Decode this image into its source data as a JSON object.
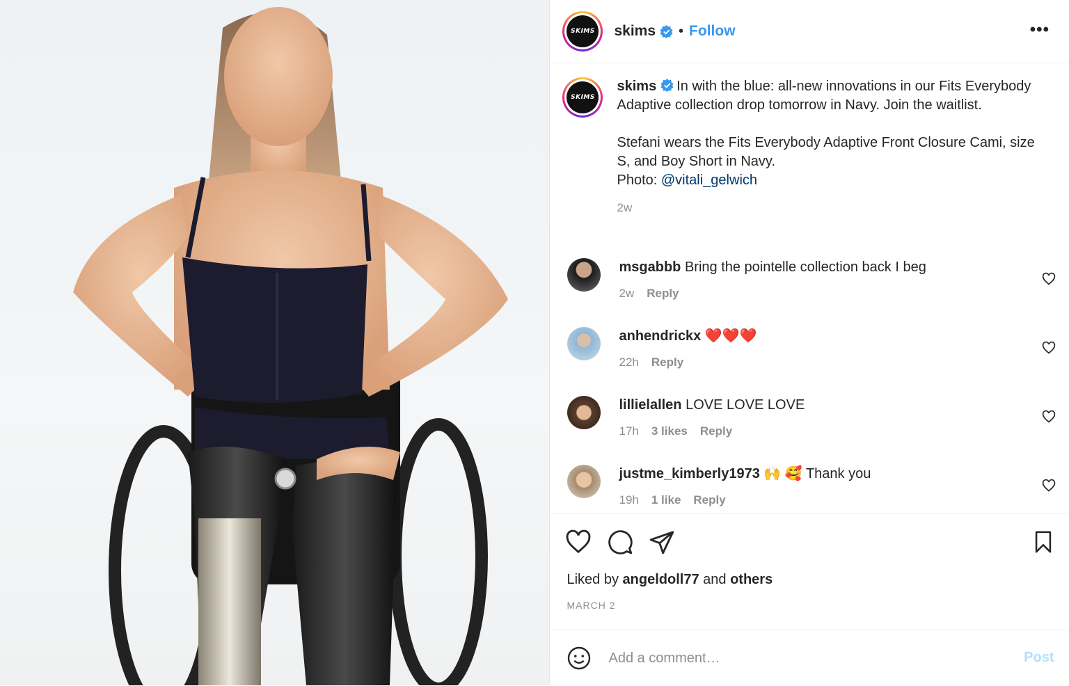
{
  "brand_colors": {
    "link": "#3897f0",
    "mention": "#00376b",
    "muted": "#8e8e8e",
    "heart_emoji": "#e0245e"
  },
  "media": {
    "alt_image": "photo"
  },
  "header": {
    "avatar_logo": "SKIMS",
    "username": "skims",
    "separator": "•",
    "follow_label": "Follow",
    "more_label": "•••"
  },
  "caption": {
    "username": "skims",
    "text": "In with the blue: all-new innovations in our Fits Everybody Adaptive collection drop tomorrow in Navy. Join the waitlist.\n\nStefani wears the Fits Everybody Adaptive Front Closure Cami, size S, and Boy Short in Navy.\nPhoto: ",
    "mention": "@vitali_gelwich",
    "time": "2w"
  },
  "comments": [
    {
      "username": "msgabbb",
      "text": "Bring the pointelle collection back I beg",
      "time": "2w",
      "likes": "",
      "reply": "Reply"
    },
    {
      "username": "anhendrickx",
      "text": "❤️❤️❤️",
      "time": "22h",
      "likes": "",
      "reply": "Reply"
    },
    {
      "username": "lillielallen",
      "text": "LOVE LOVE LOVE",
      "time": "17h",
      "likes": "3 likes",
      "reply": "Reply"
    },
    {
      "username": "justme_kimberly1973",
      "text": "🙌 🥰 Thank you",
      "time": "19h",
      "likes": "1 like",
      "reply": "Reply"
    }
  ],
  "actions": {
    "liked_prefix": "Liked by",
    "liked_user": "angeldoll77",
    "liked_and": "and",
    "liked_others": "others",
    "date": "MARCH 2"
  },
  "add_comment": {
    "placeholder": "Add a comment…",
    "post_label": "Post"
  }
}
